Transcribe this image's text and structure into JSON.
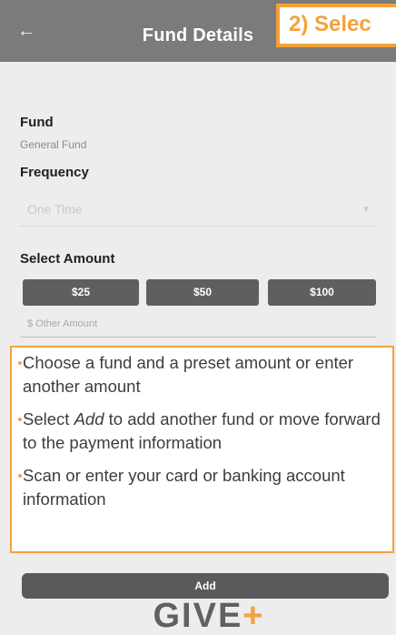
{
  "header": {
    "back_icon": "arrow-left-icon",
    "title": "Fund Details"
  },
  "step_label": "2) Selec",
  "form": {
    "fund_label": "Fund",
    "fund_value": "General Fund",
    "frequency_label": "Frequency",
    "frequency_value": "One Time",
    "select_amount_label": "Select Amount",
    "amount_options": [
      "$25",
      "$50",
      "$100"
    ],
    "other_amount_placeholder": "$ Other Amount"
  },
  "instructions": {
    "item1": "Choose a fund and a preset amount or enter another amount",
    "item2_part1": "Select ",
    "item2_italic": "Add",
    "item2_part2": " to add another fund or move forward to the payment information",
    "item3": "Scan or enter your card or banking account information"
  },
  "actions": {
    "add_label": "Add"
  },
  "logo": {
    "text": "GIVE",
    "plus": "+"
  },
  "colors": {
    "accent": "#f4a23b",
    "topbar": "#7b7b7b",
    "button": "#5f5f5f",
    "background": "#ededed"
  }
}
